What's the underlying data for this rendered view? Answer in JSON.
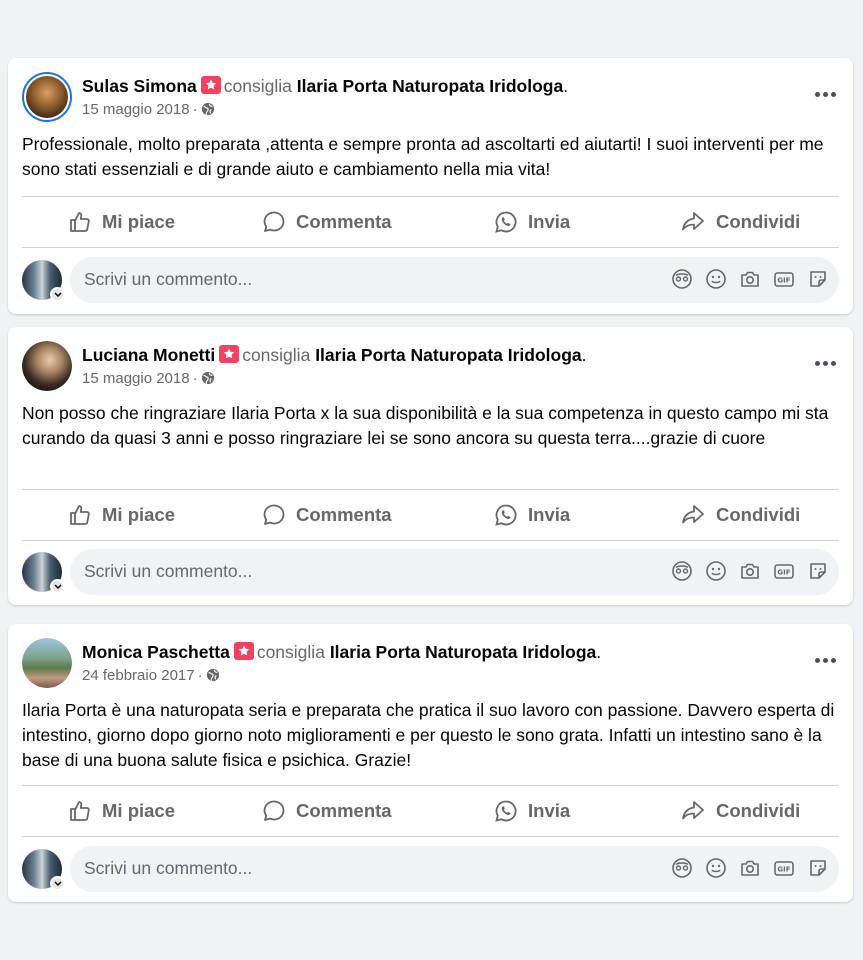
{
  "posts": [
    {
      "author": "Sulas Simona",
      "verb": "consiglia",
      "page": "Ilaria Porta Naturopata Iridologa",
      "period": ".",
      "date": "15 maggio 2018",
      "dot": "·",
      "text": "Professionale, molto preparata ,attenta e sempre pronta ad ascoltarti ed aiutarti! I suoi interventi per me sono stati essenziali e di grande aiuto e cambiamento nella mia vita!"
    },
    {
      "author": "Luciana Monetti",
      "verb": "consiglia",
      "page": "Ilaria Porta Naturopata Iridologa",
      "period": ".",
      "date": "15 maggio 2018",
      "dot": "·",
      "text": "Non posso che ringraziare Ilaria Porta x la sua disponibilità e la sua competenza in questo campo mi sta curando da quasi 3 anni e posso ringraziare lei se sono ancora su questa terra....grazie di cuore"
    },
    {
      "author": "Monica Paschetta",
      "verb": "consiglia",
      "page": "Ilaria Porta Naturopata Iridologa",
      "period": ".",
      "date": "24 febbraio 2017",
      "dot": "·",
      "text": "Ilaria Porta è una naturopata seria e preparata che pratica il suo lavoro con passione. Davvero esperta di intestino, giorno dopo giorno noto miglioramenti e per questo le sono grata. Infatti un intestino sano è la base di una buona salute fisica e psichica. Grazie!"
    }
  ],
  "actions": {
    "like": "Mi piace",
    "comment": "Commenta",
    "send": "Invia",
    "share": "Condividi"
  },
  "comment_placeholder": "Scrivi un commento...",
  "icons": {
    "recommend": "recommend-star-icon",
    "audience": "globe-icon",
    "more": "more-options-icon",
    "like": "thumbs-up-icon",
    "comment": "speech-bubble-icon",
    "send": "whatsapp-icon",
    "share": "share-arrow-icon",
    "avatar_sticker": "avatar-sticker-icon",
    "emoji": "emoji-icon",
    "camera": "camera-icon",
    "gif": "gif-icon",
    "sticker": "sticker-icon"
  },
  "colors": {
    "background": "#f0f2f5",
    "card": "#ffffff",
    "recommend_badge": "#f3425f",
    "secondary_text": "#65676b",
    "avatar_ring": "#1b74e4"
  }
}
